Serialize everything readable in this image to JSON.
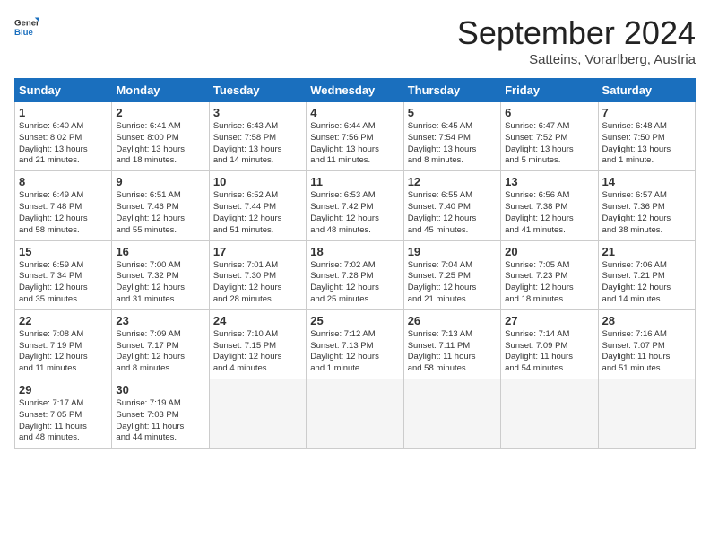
{
  "header": {
    "logo_line1": "General",
    "logo_line2": "Blue",
    "title": "September 2024",
    "subtitle": "Satteins, Vorarlberg, Austria"
  },
  "weekdays": [
    "Sunday",
    "Monday",
    "Tuesday",
    "Wednesday",
    "Thursday",
    "Friday",
    "Saturday"
  ],
  "weeks": [
    [
      {
        "day": "1",
        "info": "Sunrise: 6:40 AM\nSunset: 8:02 PM\nDaylight: 13 hours\nand 21 minutes."
      },
      {
        "day": "2",
        "info": "Sunrise: 6:41 AM\nSunset: 8:00 PM\nDaylight: 13 hours\nand 18 minutes."
      },
      {
        "day": "3",
        "info": "Sunrise: 6:43 AM\nSunset: 7:58 PM\nDaylight: 13 hours\nand 14 minutes."
      },
      {
        "day": "4",
        "info": "Sunrise: 6:44 AM\nSunset: 7:56 PM\nDaylight: 13 hours\nand 11 minutes."
      },
      {
        "day": "5",
        "info": "Sunrise: 6:45 AM\nSunset: 7:54 PM\nDaylight: 13 hours\nand 8 minutes."
      },
      {
        "day": "6",
        "info": "Sunrise: 6:47 AM\nSunset: 7:52 PM\nDaylight: 13 hours\nand 5 minutes."
      },
      {
        "day": "7",
        "info": "Sunrise: 6:48 AM\nSunset: 7:50 PM\nDaylight: 13 hours\nand 1 minute."
      }
    ],
    [
      {
        "day": "8",
        "info": "Sunrise: 6:49 AM\nSunset: 7:48 PM\nDaylight: 12 hours\nand 58 minutes."
      },
      {
        "day": "9",
        "info": "Sunrise: 6:51 AM\nSunset: 7:46 PM\nDaylight: 12 hours\nand 55 minutes."
      },
      {
        "day": "10",
        "info": "Sunrise: 6:52 AM\nSunset: 7:44 PM\nDaylight: 12 hours\nand 51 minutes."
      },
      {
        "day": "11",
        "info": "Sunrise: 6:53 AM\nSunset: 7:42 PM\nDaylight: 12 hours\nand 48 minutes."
      },
      {
        "day": "12",
        "info": "Sunrise: 6:55 AM\nSunset: 7:40 PM\nDaylight: 12 hours\nand 45 minutes."
      },
      {
        "day": "13",
        "info": "Sunrise: 6:56 AM\nSunset: 7:38 PM\nDaylight: 12 hours\nand 41 minutes."
      },
      {
        "day": "14",
        "info": "Sunrise: 6:57 AM\nSunset: 7:36 PM\nDaylight: 12 hours\nand 38 minutes."
      }
    ],
    [
      {
        "day": "15",
        "info": "Sunrise: 6:59 AM\nSunset: 7:34 PM\nDaylight: 12 hours\nand 35 minutes."
      },
      {
        "day": "16",
        "info": "Sunrise: 7:00 AM\nSunset: 7:32 PM\nDaylight: 12 hours\nand 31 minutes."
      },
      {
        "day": "17",
        "info": "Sunrise: 7:01 AM\nSunset: 7:30 PM\nDaylight: 12 hours\nand 28 minutes."
      },
      {
        "day": "18",
        "info": "Sunrise: 7:02 AM\nSunset: 7:28 PM\nDaylight: 12 hours\nand 25 minutes."
      },
      {
        "day": "19",
        "info": "Sunrise: 7:04 AM\nSunset: 7:25 PM\nDaylight: 12 hours\nand 21 minutes."
      },
      {
        "day": "20",
        "info": "Sunrise: 7:05 AM\nSunset: 7:23 PM\nDaylight: 12 hours\nand 18 minutes."
      },
      {
        "day": "21",
        "info": "Sunrise: 7:06 AM\nSunset: 7:21 PM\nDaylight: 12 hours\nand 14 minutes."
      }
    ],
    [
      {
        "day": "22",
        "info": "Sunrise: 7:08 AM\nSunset: 7:19 PM\nDaylight: 12 hours\nand 11 minutes."
      },
      {
        "day": "23",
        "info": "Sunrise: 7:09 AM\nSunset: 7:17 PM\nDaylight: 12 hours\nand 8 minutes."
      },
      {
        "day": "24",
        "info": "Sunrise: 7:10 AM\nSunset: 7:15 PM\nDaylight: 12 hours\nand 4 minutes."
      },
      {
        "day": "25",
        "info": "Sunrise: 7:12 AM\nSunset: 7:13 PM\nDaylight: 12 hours\nand 1 minute."
      },
      {
        "day": "26",
        "info": "Sunrise: 7:13 AM\nSunset: 7:11 PM\nDaylight: 11 hours\nand 58 minutes."
      },
      {
        "day": "27",
        "info": "Sunrise: 7:14 AM\nSunset: 7:09 PM\nDaylight: 11 hours\nand 54 minutes."
      },
      {
        "day": "28",
        "info": "Sunrise: 7:16 AM\nSunset: 7:07 PM\nDaylight: 11 hours\nand 51 minutes."
      }
    ],
    [
      {
        "day": "29",
        "info": "Sunrise: 7:17 AM\nSunset: 7:05 PM\nDaylight: 11 hours\nand 48 minutes."
      },
      {
        "day": "30",
        "info": "Sunrise: 7:19 AM\nSunset: 7:03 PM\nDaylight: 11 hours\nand 44 minutes."
      },
      {
        "day": "",
        "info": ""
      },
      {
        "day": "",
        "info": ""
      },
      {
        "day": "",
        "info": ""
      },
      {
        "day": "",
        "info": ""
      },
      {
        "day": "",
        "info": ""
      }
    ]
  ]
}
